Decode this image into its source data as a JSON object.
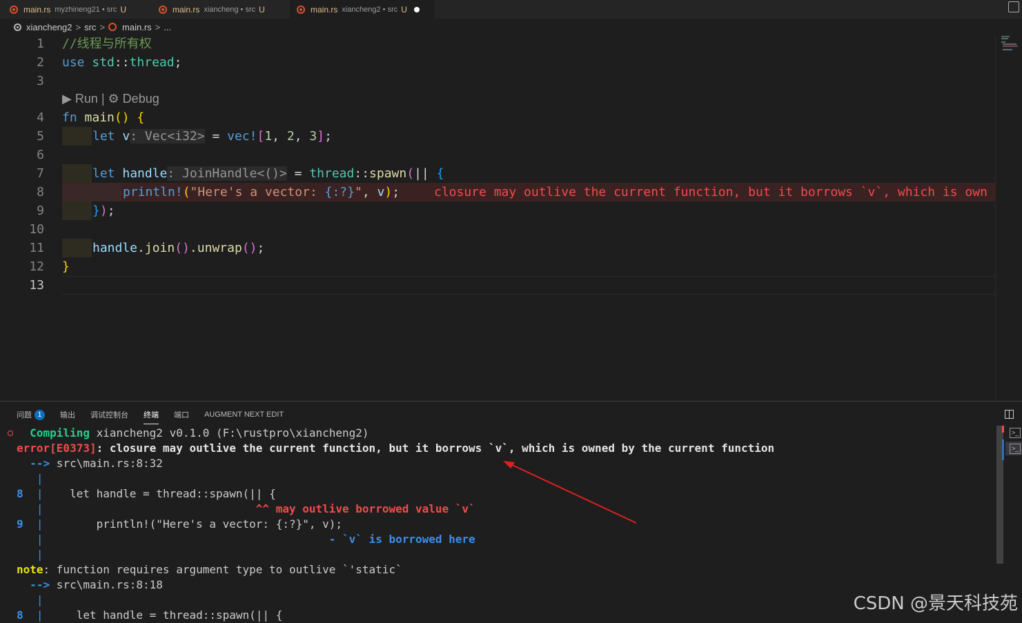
{
  "tabs": [
    {
      "file": "main.rs",
      "desc": "myzhineng21 • src",
      "badge": "U"
    },
    {
      "file": "main.rs",
      "desc": "xiancheng • src",
      "badge": "U"
    },
    {
      "file": "main.rs",
      "desc": "xiancheng2 • src",
      "badge": "U"
    }
  ],
  "breadcrumb": {
    "folder": "xiancheng2",
    "sep": ">",
    "src": "src",
    "file": "main.rs",
    "more": "..."
  },
  "editor": {
    "line_numbers": [
      "1",
      "2",
      "3",
      "4",
      "5",
      "6",
      "7",
      "8",
      "9",
      "10",
      "11",
      "12",
      "13"
    ],
    "codelens": "▶ Run | ⚙ Debug",
    "lines": {
      "l1": "//线程与所有权",
      "l2_kw": "use",
      "l2_path": "std",
      "l2_sep": "::",
      "l2_mod": "thread",
      "l2_end": ";",
      "l4_kw": "fn",
      "l4_name": "main",
      "l4_paren": "()",
      "l4_brace": "{",
      "l5_kw": "let",
      "l5_var": "v",
      "l5_colon": ":",
      "l5_hint": "Vec<i32>",
      "l5_eq": "=",
      "l5_mac": "vec!",
      "l5_open": "[",
      "l5_n1": "1",
      "l5_c1": ",",
      "l5_n2": "2",
      "l5_c2": ",",
      "l5_n3": "3",
      "l5_close": "]",
      "l5_end": ";",
      "l7_kw": "let",
      "l7_var": "handle",
      "l7_colon": ":",
      "l7_hint": "JoinHandle<()>",
      "l7_eq": "=",
      "l7_mod": "thread",
      "l7_sep": "::",
      "l7_fn": "spawn",
      "l7_open": "(",
      "l7_pipes": "||",
      "l7_brace": "{",
      "l8_mac": "println!",
      "l8_open": "(",
      "l8_str1": "\"Here's a vector: ",
      "l8_fmt": "{:?}",
      "l8_str2": "\"",
      "l8_comma": ",",
      "l8_var": "v",
      "l8_close": ")",
      "l8_end": ";",
      "l8_error": "closure may outlive the current function, but it borrows `v`, which is own",
      "l9_brace": "}",
      "l9_paren": ")",
      "l9_end": ";",
      "l11_var": "handle",
      "l11_dot1": ".",
      "l11_join": "join",
      "l11_p1": "()",
      "l11_dot2": ".",
      "l11_unwrap": "unwrap",
      "l11_p2": "()",
      "l11_end": ";",
      "l12_brace": "}"
    }
  },
  "panel": {
    "tabs": [
      "问题",
      "输出",
      "调试控制台",
      "终端",
      "端口",
      "AUGMENT NEXT EDIT"
    ],
    "problems_count": "1",
    "terminal": {
      "t1_kw": "Compiling",
      "t1_rest": " xiancheng2 v0.1.0 (F:\\rustpro\\xiancheng2)",
      "t2_err": "error[E0373]",
      "t2_msg": ": closure may outlive the current function, but it borrows `v`, which is owned by the current function",
      "t3_arrow": "-->",
      "t3_loc": " src\\main.rs:8:32",
      "gutter": "|",
      "t5_num": "8",
      "t5_code": "    let handle = thread::spawn(|| {",
      "t6_marker": "^^ may outlive borrowed value `v`",
      "t7_num": "9",
      "t7_code": "        println!(\"Here's a vector: {:?}\", v);",
      "t8_marker": "- `v` is borrowed here",
      "t10_note": "note",
      "t10_msg": ": function requires argument type to outlive `'static`",
      "t11_arrow": "-->",
      "t11_loc": " src\\main.rs:8:18",
      "t13_num": "8",
      "t13_code": "     let handle = thread::spawn(|| {"
    }
  },
  "watermark": "CSDN @景天科技苑",
  "colors": {
    "error": "#f14c4c",
    "accent": "#0e70c0",
    "annotation_arrow": "#e02020"
  }
}
